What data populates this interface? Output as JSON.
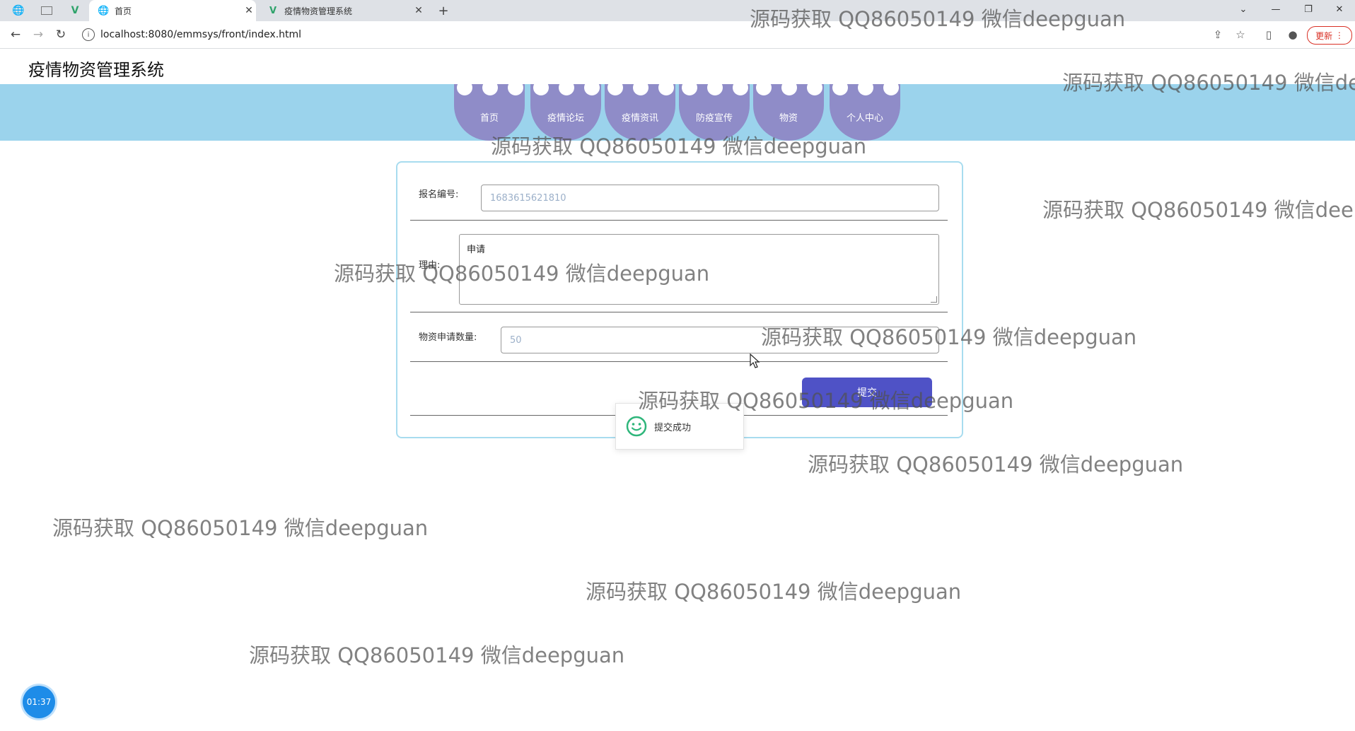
{
  "browser": {
    "tabs": [
      {
        "title": "首页",
        "icon": "globe-icon",
        "active": true
      },
      {
        "title": "疫情物资管理系统",
        "icon": "vue-logo-icon",
        "active": false
      }
    ],
    "url": "localhost:8080/emmsys/front/index.html",
    "update_label": "更新"
  },
  "site": {
    "title": "疫情物资管理系统",
    "nav": [
      "首页",
      "疫情论坛",
      "疫情资讯",
      "防疫宣传",
      "物资",
      "个人中心"
    ]
  },
  "form": {
    "reg_no_label": "报名编号:",
    "reg_no_value": "1683615621810",
    "reason_label": "理由:",
    "reason_value": "申请",
    "qty_label": "物资申请数量:",
    "qty_value": "50",
    "submit_label": "提交"
  },
  "toast": {
    "message": "提交成功"
  },
  "timer": "01:37",
  "watermark_text": "源码获取 QQ86050149 微信deepguan",
  "colors": {
    "nav_band": "#9bd3ec",
    "nav_item": "#8f8cc8",
    "submit": "#4f52c6",
    "card_border": "#a8dcef",
    "toast_icon": "#2fb67b",
    "timer": "#1e8ce8"
  }
}
